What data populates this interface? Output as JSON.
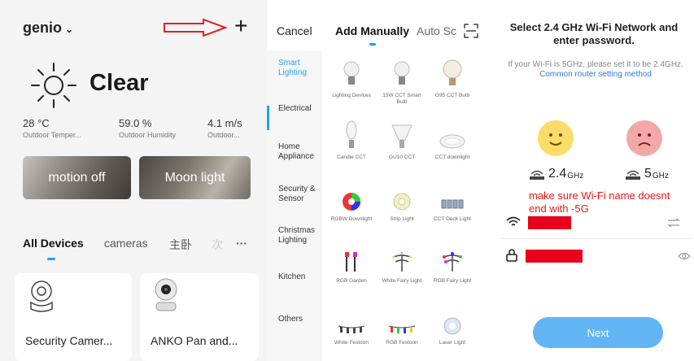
{
  "panel_home": {
    "home_name": "genio",
    "chevron": "chevron-down-icon",
    "add_icon": "+",
    "weather": "Clear",
    "stats": [
      {
        "value": "28 °C",
        "label": "Outdoor Temper..."
      },
      {
        "value": "59.0 %",
        "label": "Outdoor Humidity"
      },
      {
        "value": "4.1 m/s",
        "label": "Outdoor..."
      }
    ],
    "scenes": [
      "motion off",
      "Moon light"
    ],
    "tabs": {
      "active": "All Devices",
      "second": "cameras",
      "third": "主卧",
      "faded": "次",
      "more": "···"
    },
    "devices": [
      "Security Camer...",
      "ANKO Pan and..."
    ],
    "accent": "#22a0f0",
    "annotation_arrow_color": "#e02020"
  },
  "panel_add": {
    "cancel": "Cancel",
    "tab_manual": "Add Manually",
    "tab_auto": "Auto Sc",
    "categories": [
      "Smart Lighting",
      "Electrical",
      "Home Appliance",
      "Security & Sensor",
      "Christmas Lighting",
      "Kitchen",
      "Others"
    ],
    "devices": [
      [
        "Lighting Devices",
        "15W CCT Smart Bulb",
        "G95 CCT Bulb"
      ],
      [
        "Candle CCT",
        "GU10 CCT",
        "CCT downlight"
      ],
      [
        "RGBW Downlight",
        "Strip Light",
        "CCT Deck Light"
      ],
      [
        "RGB Garden",
        "White Fairy Light",
        "RGB Fairy Light"
      ],
      [
        "White Festoon",
        "RGB Festoon",
        "Laser Light"
      ]
    ]
  },
  "panel_wifi": {
    "title": "Select 2.4 GHz Wi-Fi Network and enter password.",
    "hint": "If your Wi-Fi is 5GHz, please set it to be 2.4GHz.",
    "hint_link": "Common router setting method",
    "band_ok": "2.4",
    "band_bad": "5",
    "unit": "GHz",
    "note": "make sure Wi-Fi name doesnt end with -5G",
    "next": "Next",
    "note_color": "#e81818",
    "button_color": "#62b5f4"
  }
}
